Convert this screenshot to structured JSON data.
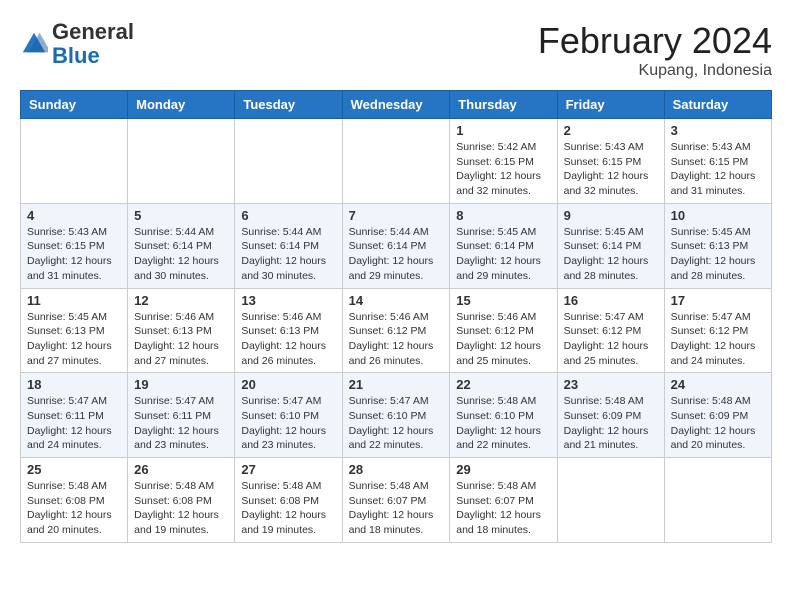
{
  "header": {
    "logo_general": "General",
    "logo_blue": "Blue",
    "month_title": "February 2024",
    "location": "Kupang, Indonesia"
  },
  "days_of_week": [
    "Sunday",
    "Monday",
    "Tuesday",
    "Wednesday",
    "Thursday",
    "Friday",
    "Saturday"
  ],
  "weeks": [
    [
      {
        "day": "",
        "info": ""
      },
      {
        "day": "",
        "info": ""
      },
      {
        "day": "",
        "info": ""
      },
      {
        "day": "",
        "info": ""
      },
      {
        "day": "1",
        "info": "Sunrise: 5:42 AM\nSunset: 6:15 PM\nDaylight: 12 hours\nand 32 minutes."
      },
      {
        "day": "2",
        "info": "Sunrise: 5:43 AM\nSunset: 6:15 PM\nDaylight: 12 hours\nand 32 minutes."
      },
      {
        "day": "3",
        "info": "Sunrise: 5:43 AM\nSunset: 6:15 PM\nDaylight: 12 hours\nand 31 minutes."
      }
    ],
    [
      {
        "day": "4",
        "info": "Sunrise: 5:43 AM\nSunset: 6:15 PM\nDaylight: 12 hours\nand 31 minutes."
      },
      {
        "day": "5",
        "info": "Sunrise: 5:44 AM\nSunset: 6:14 PM\nDaylight: 12 hours\nand 30 minutes."
      },
      {
        "day": "6",
        "info": "Sunrise: 5:44 AM\nSunset: 6:14 PM\nDaylight: 12 hours\nand 30 minutes."
      },
      {
        "day": "7",
        "info": "Sunrise: 5:44 AM\nSunset: 6:14 PM\nDaylight: 12 hours\nand 29 minutes."
      },
      {
        "day": "8",
        "info": "Sunrise: 5:45 AM\nSunset: 6:14 PM\nDaylight: 12 hours\nand 29 minutes."
      },
      {
        "day": "9",
        "info": "Sunrise: 5:45 AM\nSunset: 6:14 PM\nDaylight: 12 hours\nand 28 minutes."
      },
      {
        "day": "10",
        "info": "Sunrise: 5:45 AM\nSunset: 6:13 PM\nDaylight: 12 hours\nand 28 minutes."
      }
    ],
    [
      {
        "day": "11",
        "info": "Sunrise: 5:45 AM\nSunset: 6:13 PM\nDaylight: 12 hours\nand 27 minutes."
      },
      {
        "day": "12",
        "info": "Sunrise: 5:46 AM\nSunset: 6:13 PM\nDaylight: 12 hours\nand 27 minutes."
      },
      {
        "day": "13",
        "info": "Sunrise: 5:46 AM\nSunset: 6:13 PM\nDaylight: 12 hours\nand 26 minutes."
      },
      {
        "day": "14",
        "info": "Sunrise: 5:46 AM\nSunset: 6:12 PM\nDaylight: 12 hours\nand 26 minutes."
      },
      {
        "day": "15",
        "info": "Sunrise: 5:46 AM\nSunset: 6:12 PM\nDaylight: 12 hours\nand 25 minutes."
      },
      {
        "day": "16",
        "info": "Sunrise: 5:47 AM\nSunset: 6:12 PM\nDaylight: 12 hours\nand 25 minutes."
      },
      {
        "day": "17",
        "info": "Sunrise: 5:47 AM\nSunset: 6:12 PM\nDaylight: 12 hours\nand 24 minutes."
      }
    ],
    [
      {
        "day": "18",
        "info": "Sunrise: 5:47 AM\nSunset: 6:11 PM\nDaylight: 12 hours\nand 24 minutes."
      },
      {
        "day": "19",
        "info": "Sunrise: 5:47 AM\nSunset: 6:11 PM\nDaylight: 12 hours\nand 23 minutes."
      },
      {
        "day": "20",
        "info": "Sunrise: 5:47 AM\nSunset: 6:10 PM\nDaylight: 12 hours\nand 23 minutes."
      },
      {
        "day": "21",
        "info": "Sunrise: 5:47 AM\nSunset: 6:10 PM\nDaylight: 12 hours\nand 22 minutes."
      },
      {
        "day": "22",
        "info": "Sunrise: 5:48 AM\nSunset: 6:10 PM\nDaylight: 12 hours\nand 22 minutes."
      },
      {
        "day": "23",
        "info": "Sunrise: 5:48 AM\nSunset: 6:09 PM\nDaylight: 12 hours\nand 21 minutes."
      },
      {
        "day": "24",
        "info": "Sunrise: 5:48 AM\nSunset: 6:09 PM\nDaylight: 12 hours\nand 20 minutes."
      }
    ],
    [
      {
        "day": "25",
        "info": "Sunrise: 5:48 AM\nSunset: 6:08 PM\nDaylight: 12 hours\nand 20 minutes."
      },
      {
        "day": "26",
        "info": "Sunrise: 5:48 AM\nSunset: 6:08 PM\nDaylight: 12 hours\nand 19 minutes."
      },
      {
        "day": "27",
        "info": "Sunrise: 5:48 AM\nSunset: 6:08 PM\nDaylight: 12 hours\nand 19 minutes."
      },
      {
        "day": "28",
        "info": "Sunrise: 5:48 AM\nSunset: 6:07 PM\nDaylight: 12 hours\nand 18 minutes."
      },
      {
        "day": "29",
        "info": "Sunrise: 5:48 AM\nSunset: 6:07 PM\nDaylight: 12 hours\nand 18 minutes."
      },
      {
        "day": "",
        "info": ""
      },
      {
        "day": "",
        "info": ""
      }
    ]
  ]
}
